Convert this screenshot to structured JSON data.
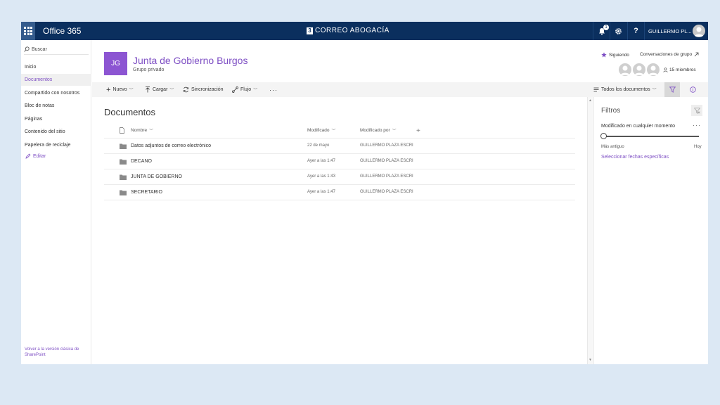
{
  "suitebar": {
    "app_name": "Office 365",
    "brand_mark": "3",
    "brand": "CORREO ABOGACÍA",
    "notification_count": "1",
    "help": "?",
    "user_name": "GUILLERMO PL..."
  },
  "nav": {
    "search_label": "Buscar",
    "items": [
      {
        "label": "Inicio",
        "selected": false
      },
      {
        "label": "Documentos",
        "selected": true
      },
      {
        "label": "Compartido con nosotros",
        "selected": false
      },
      {
        "label": "Bloc de notas",
        "selected": false
      },
      {
        "label": "Páginas",
        "selected": false
      },
      {
        "label": "Contenido del sitio",
        "selected": false
      },
      {
        "label": "Papelera de reciclaje",
        "selected": false
      }
    ],
    "edit_label": "Editar",
    "classic_link": "Volver a la versión clásica de SharePoint"
  },
  "site": {
    "logo_initials": "JG",
    "title": "Junta de Gobierno Burgos",
    "subtitle": "Grupo privado",
    "following_label": "Siguiendo",
    "conversations_label": "Conversaciones de grupo",
    "members_label": "15 miembros"
  },
  "commands": {
    "new": "Nuevo",
    "upload": "Cargar",
    "sync": "Sincronización",
    "flow": "Flujo",
    "more": "···",
    "view": "Todos los documentos"
  },
  "library": {
    "title": "Documentos",
    "columns": {
      "name": "Nombre",
      "modified": "Modificado",
      "modified_by": "Modificado por",
      "add": "+"
    },
    "rows": [
      {
        "name": "Datos adjuntos de correo electrónico",
        "modified": "22 de mayo",
        "modified_by": "GUILLERMO PLAZA ESCRI"
      },
      {
        "name": "DECANO",
        "modified": "Ayer a las 1:47",
        "modified_by": "GUILLERMO PLAZA ESCRI"
      },
      {
        "name": "JUNTA DE GOBIERNO",
        "modified": "Ayer a las 1:43",
        "modified_by": "GUILLERMO PLAZA ESCRI"
      },
      {
        "name": "SECRETARIO",
        "modified": "Ayer a las 1:47",
        "modified_by": "GUILLERMO PLAZA ESCRI"
      }
    ]
  },
  "filters": {
    "title": "Filtros",
    "modified_label": "Modificado en cualquier momento",
    "more": "···",
    "slider_left": "Más antiguo",
    "slider_right": "Hoy",
    "slider_value": 0,
    "specific_dates_link": "Seleccionar fechas específicas"
  },
  "colors": {
    "suitebar": "#0b2f5e",
    "accent": "#7e4fc4",
    "logo": "#8c55d2"
  },
  "icons": {
    "app_launcher": "waffle-icon",
    "search": "search-icon",
    "bell": "bell-icon",
    "settings": "gear-icon",
    "help": "help-icon",
    "edit": "pencil-icon",
    "star": "star-icon",
    "external": "arrow-up-right-icon",
    "person": "person-icon",
    "folder": "folder-icon",
    "filter": "filter-icon",
    "info": "info-icon"
  }
}
